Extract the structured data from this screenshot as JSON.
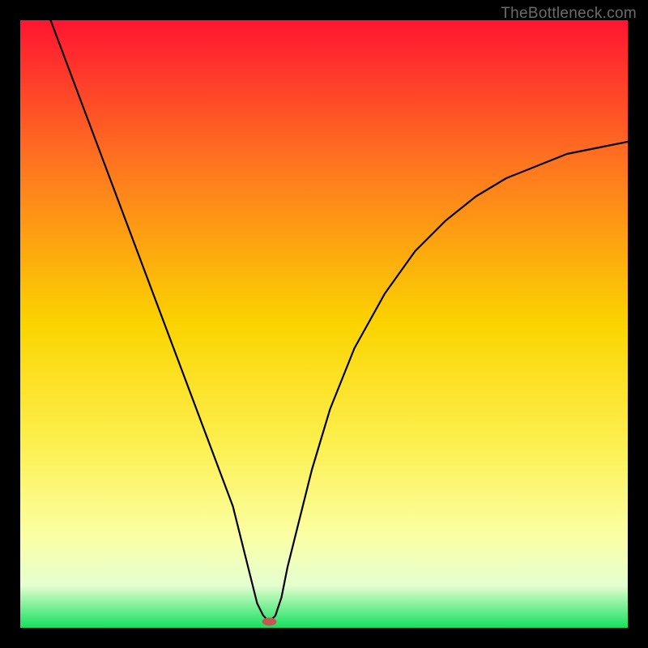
{
  "watermark": "TheBottleneck.com",
  "chart_data": {
    "type": "line",
    "title": "",
    "xlabel": "",
    "ylabel": "",
    "xlim": [
      0,
      100
    ],
    "ylim": [
      0,
      100
    ],
    "series": [
      {
        "name": "bottleneck-curve",
        "x": [
          5,
          8,
          11,
          14,
          17,
          20,
          23,
          26,
          29,
          32,
          35,
          37,
          38,
          39,
          40,
          41,
          42,
          43,
          44,
          46,
          48,
          51,
          55,
          60,
          65,
          70,
          75,
          80,
          85,
          90,
          95,
          100
        ],
        "y": [
          100,
          92,
          84,
          76,
          68,
          60,
          52,
          44,
          36,
          28,
          20,
          12,
          8,
          4,
          2,
          1,
          2,
          5,
          10,
          18,
          26,
          36,
          46,
          55,
          62,
          67,
          71,
          74,
          76,
          78,
          79,
          80
        ]
      }
    ],
    "optimal_point": {
      "x": 41,
      "y": 1
    },
    "gradient_stops": [
      {
        "offset": 0,
        "color": "#ff1532"
      },
      {
        "offset": 25,
        "color": "#ff7a1e"
      },
      {
        "offset": 50,
        "color": "#fbd400"
      },
      {
        "offset": 70,
        "color": "#fcf050"
      },
      {
        "offset": 85,
        "color": "#fbffa5"
      },
      {
        "offset": 93,
        "color": "#e5ffd0"
      },
      {
        "offset": 100,
        "color": "#14e060"
      }
    ],
    "marker": {
      "color": "#c35a52",
      "rx": 9,
      "ry": 5
    }
  }
}
